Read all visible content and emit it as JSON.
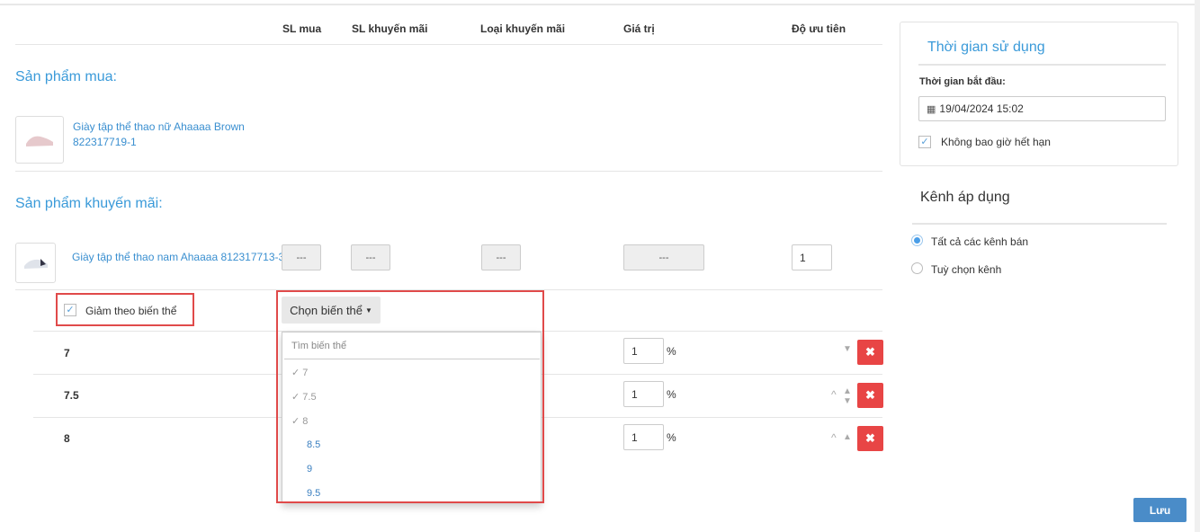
{
  "table_headers": [
    "SL mua",
    "SL khuyến mãi",
    "Loại khuyến mãi",
    "Giá trị",
    "Độ ưu tiên"
  ],
  "buy_section": {
    "title": "Sản phẩm mua:",
    "product_name": "Giày tập thể thao nữ Ahaaaa Brown",
    "product_sku": "822317719-1"
  },
  "promo_section": {
    "title": "Sản phẩm khuyến mãi:",
    "product_name": "Giày tập thể thao nam Ahaaaa 812317713-3",
    "sl_mua": "---",
    "sl_km": "---",
    "loai_km": "---",
    "gia_tri": "---",
    "priority": "1"
  },
  "variant_checkbox": {
    "label": "Giảm theo biến thể",
    "checked": true
  },
  "variant_dropdown": {
    "button_label": "Chọn biến thể",
    "search_placeholder": "Tìm biến thể",
    "options": [
      {
        "label": "7",
        "selected": true
      },
      {
        "label": "7.5",
        "selected": true
      },
      {
        "label": "8",
        "selected": true
      },
      {
        "label": "8.5",
        "selected": false
      },
      {
        "label": "9",
        "selected": false
      },
      {
        "label": "9.5",
        "selected": false
      }
    ],
    "check_icon": "✓"
  },
  "variant_rows": [
    {
      "name": "7",
      "value": "1",
      "unit": "%"
    },
    {
      "name": "7.5",
      "value": "1",
      "unit": "%"
    },
    {
      "name": "8",
      "value": "1",
      "unit": "%"
    }
  ],
  "delete_icon": "✖",
  "usage_time": {
    "title": "Thời gian sử dụng",
    "start_label": "Thời gian bắt đầu:",
    "start_value": "19/04/2024 15:02",
    "never_expire_label": "Không bao giờ hết hạn",
    "never_expire_checked": true
  },
  "channels": {
    "title": "Kênh áp dụng",
    "options": [
      {
        "label": "Tất cả các kênh bán",
        "selected": true
      },
      {
        "label": "Tuỳ chọn kênh",
        "selected": false
      }
    ]
  },
  "save_label": "Lưu"
}
